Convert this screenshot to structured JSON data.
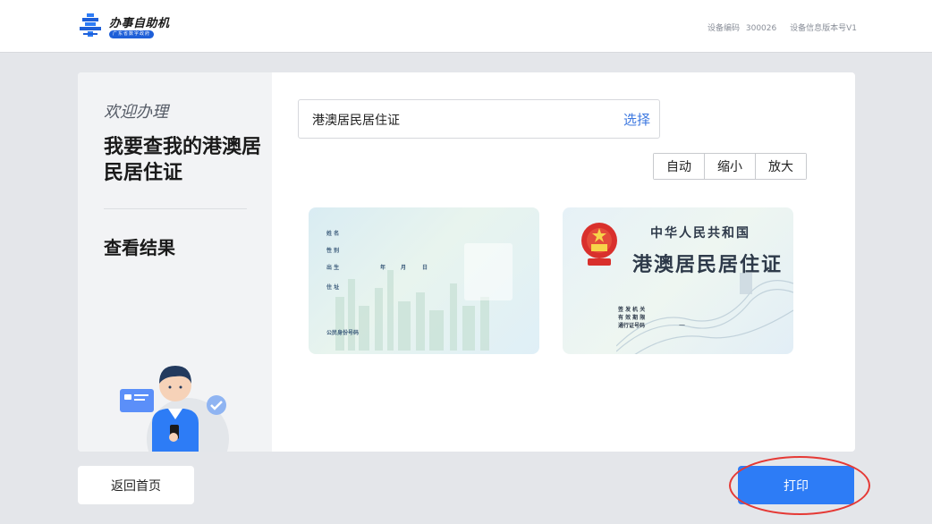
{
  "header": {
    "app_title": "办事自助机",
    "logo_tag": "广东省数字政府",
    "device_code_label": "设备编码",
    "device_code": "300026",
    "version_label": "设备信息版本号V1"
  },
  "left": {
    "welcome": "欢迎办理",
    "service_title": "我要查我的港澳居民居住证",
    "step_title": "查看结果"
  },
  "selector": {
    "value": "港澳居民居住证",
    "button": "选择"
  },
  "zoom": {
    "auto": "自动",
    "shrink": "缩小",
    "enlarge": "放大"
  },
  "card_front": {
    "name": "姓 名",
    "gender": "性 别",
    "birth": "出 生",
    "year": "年",
    "month": "月",
    "day": "日",
    "address": "住 址",
    "id_number": "公民身份号码"
  },
  "card_back": {
    "nation": "中华人民共和国",
    "doc_type": "港澳居民居住证",
    "issuer": "签 发 机 关",
    "validity": "有 效 期 限",
    "permit_no": "通行证号码",
    "validity_dash": "—"
  },
  "footer": {
    "home": "返回首页",
    "print": "打印"
  },
  "colors": {
    "primary": "#2d7cf6",
    "link": "#3d78e0",
    "highlight": "#e53935"
  }
}
